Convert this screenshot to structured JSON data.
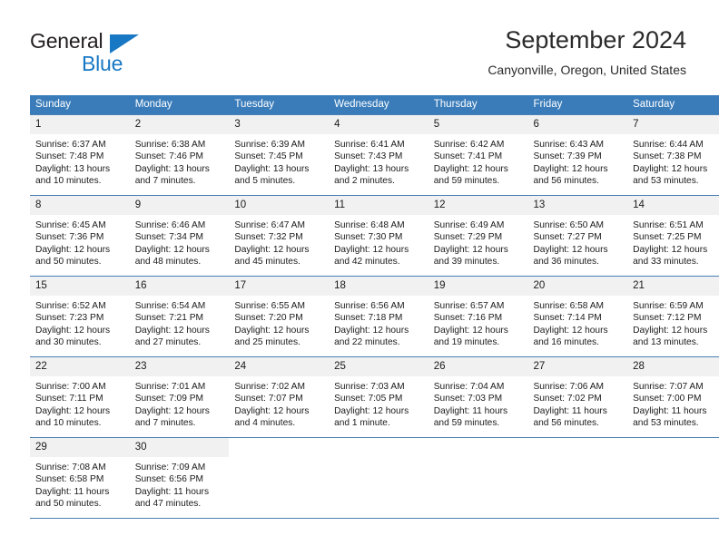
{
  "brand": {
    "line1": "General",
    "line2": "Blue",
    "triangle_color": "#1878c4"
  },
  "header": {
    "title": "September 2024",
    "location": "Canyonville, Oregon, United States"
  },
  "theme": {
    "header_bg": "#3a7cba",
    "daynum_bg": "#f1f1f1",
    "grid_line": "#4a7fb5",
    "text": "#1a1a1a"
  },
  "calendar": {
    "weekday_headers": [
      "Sunday",
      "Monday",
      "Tuesday",
      "Wednesday",
      "Thursday",
      "Friday",
      "Saturday"
    ],
    "weeks": [
      [
        {
          "day": "1",
          "sunrise": "Sunrise: 6:37 AM",
          "sunset": "Sunset: 7:48 PM",
          "daylight": "Daylight: 13 hours and 10 minutes."
        },
        {
          "day": "2",
          "sunrise": "Sunrise: 6:38 AM",
          "sunset": "Sunset: 7:46 PM",
          "daylight": "Daylight: 13 hours and 7 minutes."
        },
        {
          "day": "3",
          "sunrise": "Sunrise: 6:39 AM",
          "sunset": "Sunset: 7:45 PM",
          "daylight": "Daylight: 13 hours and 5 minutes."
        },
        {
          "day": "4",
          "sunrise": "Sunrise: 6:41 AM",
          "sunset": "Sunset: 7:43 PM",
          "daylight": "Daylight: 13 hours and 2 minutes."
        },
        {
          "day": "5",
          "sunrise": "Sunrise: 6:42 AM",
          "sunset": "Sunset: 7:41 PM",
          "daylight": "Daylight: 12 hours and 59 minutes."
        },
        {
          "day": "6",
          "sunrise": "Sunrise: 6:43 AM",
          "sunset": "Sunset: 7:39 PM",
          "daylight": "Daylight: 12 hours and 56 minutes."
        },
        {
          "day": "7",
          "sunrise": "Sunrise: 6:44 AM",
          "sunset": "Sunset: 7:38 PM",
          "daylight": "Daylight: 12 hours and 53 minutes."
        }
      ],
      [
        {
          "day": "8",
          "sunrise": "Sunrise: 6:45 AM",
          "sunset": "Sunset: 7:36 PM",
          "daylight": "Daylight: 12 hours and 50 minutes."
        },
        {
          "day": "9",
          "sunrise": "Sunrise: 6:46 AM",
          "sunset": "Sunset: 7:34 PM",
          "daylight": "Daylight: 12 hours and 48 minutes."
        },
        {
          "day": "10",
          "sunrise": "Sunrise: 6:47 AM",
          "sunset": "Sunset: 7:32 PM",
          "daylight": "Daylight: 12 hours and 45 minutes."
        },
        {
          "day": "11",
          "sunrise": "Sunrise: 6:48 AM",
          "sunset": "Sunset: 7:30 PM",
          "daylight": "Daylight: 12 hours and 42 minutes."
        },
        {
          "day": "12",
          "sunrise": "Sunrise: 6:49 AM",
          "sunset": "Sunset: 7:29 PM",
          "daylight": "Daylight: 12 hours and 39 minutes."
        },
        {
          "day": "13",
          "sunrise": "Sunrise: 6:50 AM",
          "sunset": "Sunset: 7:27 PM",
          "daylight": "Daylight: 12 hours and 36 minutes."
        },
        {
          "day": "14",
          "sunrise": "Sunrise: 6:51 AM",
          "sunset": "Sunset: 7:25 PM",
          "daylight": "Daylight: 12 hours and 33 minutes."
        }
      ],
      [
        {
          "day": "15",
          "sunrise": "Sunrise: 6:52 AM",
          "sunset": "Sunset: 7:23 PM",
          "daylight": "Daylight: 12 hours and 30 minutes."
        },
        {
          "day": "16",
          "sunrise": "Sunrise: 6:54 AM",
          "sunset": "Sunset: 7:21 PM",
          "daylight": "Daylight: 12 hours and 27 minutes."
        },
        {
          "day": "17",
          "sunrise": "Sunrise: 6:55 AM",
          "sunset": "Sunset: 7:20 PM",
          "daylight": "Daylight: 12 hours and 25 minutes."
        },
        {
          "day": "18",
          "sunrise": "Sunrise: 6:56 AM",
          "sunset": "Sunset: 7:18 PM",
          "daylight": "Daylight: 12 hours and 22 minutes."
        },
        {
          "day": "19",
          "sunrise": "Sunrise: 6:57 AM",
          "sunset": "Sunset: 7:16 PM",
          "daylight": "Daylight: 12 hours and 19 minutes."
        },
        {
          "day": "20",
          "sunrise": "Sunrise: 6:58 AM",
          "sunset": "Sunset: 7:14 PM",
          "daylight": "Daylight: 12 hours and 16 minutes."
        },
        {
          "day": "21",
          "sunrise": "Sunrise: 6:59 AM",
          "sunset": "Sunset: 7:12 PM",
          "daylight": "Daylight: 12 hours and 13 minutes."
        }
      ],
      [
        {
          "day": "22",
          "sunrise": "Sunrise: 7:00 AM",
          "sunset": "Sunset: 7:11 PM",
          "daylight": "Daylight: 12 hours and 10 minutes."
        },
        {
          "day": "23",
          "sunrise": "Sunrise: 7:01 AM",
          "sunset": "Sunset: 7:09 PM",
          "daylight": "Daylight: 12 hours and 7 minutes."
        },
        {
          "day": "24",
          "sunrise": "Sunrise: 7:02 AM",
          "sunset": "Sunset: 7:07 PM",
          "daylight": "Daylight: 12 hours and 4 minutes."
        },
        {
          "day": "25",
          "sunrise": "Sunrise: 7:03 AM",
          "sunset": "Sunset: 7:05 PM",
          "daylight": "Daylight: 12 hours and 1 minute."
        },
        {
          "day": "26",
          "sunrise": "Sunrise: 7:04 AM",
          "sunset": "Sunset: 7:03 PM",
          "daylight": "Daylight: 11 hours and 59 minutes."
        },
        {
          "day": "27",
          "sunrise": "Sunrise: 7:06 AM",
          "sunset": "Sunset: 7:02 PM",
          "daylight": "Daylight: 11 hours and 56 minutes."
        },
        {
          "day": "28",
          "sunrise": "Sunrise: 7:07 AM",
          "sunset": "Sunset: 7:00 PM",
          "daylight": "Daylight: 11 hours and 53 minutes."
        }
      ],
      [
        {
          "day": "29",
          "sunrise": "Sunrise: 7:08 AM",
          "sunset": "Sunset: 6:58 PM",
          "daylight": "Daylight: 11 hours and 50 minutes."
        },
        {
          "day": "30",
          "sunrise": "Sunrise: 7:09 AM",
          "sunset": "Sunset: 6:56 PM",
          "daylight": "Daylight: 11 hours and 47 minutes."
        },
        {
          "day": "",
          "sunrise": "",
          "sunset": "",
          "daylight": ""
        },
        {
          "day": "",
          "sunrise": "",
          "sunset": "",
          "daylight": ""
        },
        {
          "day": "",
          "sunrise": "",
          "sunset": "",
          "daylight": ""
        },
        {
          "day": "",
          "sunrise": "",
          "sunset": "",
          "daylight": ""
        },
        {
          "day": "",
          "sunrise": "",
          "sunset": "",
          "daylight": ""
        }
      ]
    ]
  }
}
